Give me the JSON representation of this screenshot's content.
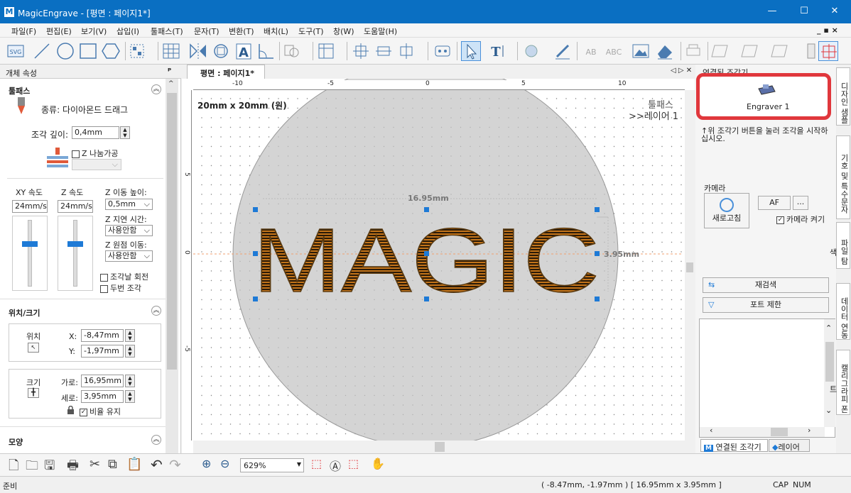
{
  "window": {
    "title": "MagicEngrave - [평면 : 페이지1*]",
    "logo": "M",
    "min": "—",
    "max": "☐",
    "close": "✕"
  },
  "mdi_controls": "_ ▪ ×",
  "menu": [
    "파일(F)",
    "편집(E)",
    "보기(V)",
    "삽입(I)",
    "툴패스(T)",
    "문자(T)",
    "변환(T)",
    "배치(L)",
    "도구(T)",
    "창(W)",
    "도움말(H)"
  ],
  "left_panel": {
    "title": "개체 속성",
    "pin": "ᴾ",
    "toolpath": {
      "header": "툴패스",
      "type_label": "종류: 다이아몬드 드래그",
      "depth_label": "조각 깊이:",
      "depth_value": "0,4mm",
      "z_split_label": "Z 나눔가공",
      "xy_speed_label": "XY 속도",
      "xy_speed_value": "24mm/s",
      "z_speed_label": "Z 속도",
      "z_speed_value": "24mm/s",
      "z_move_label": "Z 이동 높이:",
      "z_move_value": "0,5mm",
      "z_delay_label": "Z 지연 시간:",
      "z_delay_value": "사용안함",
      "z_origin_label": "Z 원점 이동:",
      "z_origin_value": "사용안함",
      "rotate_label": "조각날 회전",
      "double_label": "두번 조각"
    },
    "position": {
      "header": "위치/크기",
      "pos_label": "위치",
      "x_label": "X:",
      "x_value": "-8,47mm",
      "y_label": "Y:",
      "y_value": "-1,97mm",
      "size_label": "크기",
      "width_label": "가로:",
      "width_value": "16,95mm",
      "height_label": "세로:",
      "height_value": "3,95mm",
      "ratio_label": "비율 유지"
    },
    "shape": {
      "header": "모양"
    }
  },
  "document": {
    "tab": "평면 : 페이지1*",
    "nav": "◁ ▷ ✕",
    "material_label": "20mm x 20mm (원)",
    "toolpath_label": "툴패스",
    "layer_label": ">>레이어 1",
    "text": "MAGIC",
    "width_dim": "16.95mm",
    "height_dim": "3.95mm",
    "ruler_ticks": [
      "-10",
      "-5",
      "0",
      "5",
      "10"
    ],
    "vruler_ticks": [
      "5",
      "0",
      "-5"
    ]
  },
  "right_panel": {
    "title": "연결된 조각기",
    "engraver_name": "Engraver 1",
    "hint": "↑위 조각기 버튼을 눌러 조각을 시작하십시오.",
    "camera_header": "카메라",
    "refresh_label": "새로고침",
    "af_label": "AF",
    "more_label": "...",
    "camera_on_label": "카메라 켜기",
    "rescan_label": "재검색",
    "port_limit_label": "포트 제한",
    "tab_connected": "연결된 조각기",
    "tab_layer": "레이어"
  },
  "side_tabs": [
    "디자인 샘플",
    "기호 및 특수문자",
    "파일 탐색",
    "데이터 연동",
    "캘리그라피 폰트"
  ],
  "bottom": {
    "zoom": "629%"
  },
  "status": {
    "left": "준비",
    "coords": "( -8.47mm, -1.97mm ) [ 16.95mm x 3.95mm ]",
    "cap": "CAP",
    "num": "NUM"
  },
  "colors": {
    "titlebar": "#0a6fc2",
    "accent": "#1e7ad6",
    "highlight": "#e0373c",
    "engrave_orange": "#e98a1e"
  }
}
